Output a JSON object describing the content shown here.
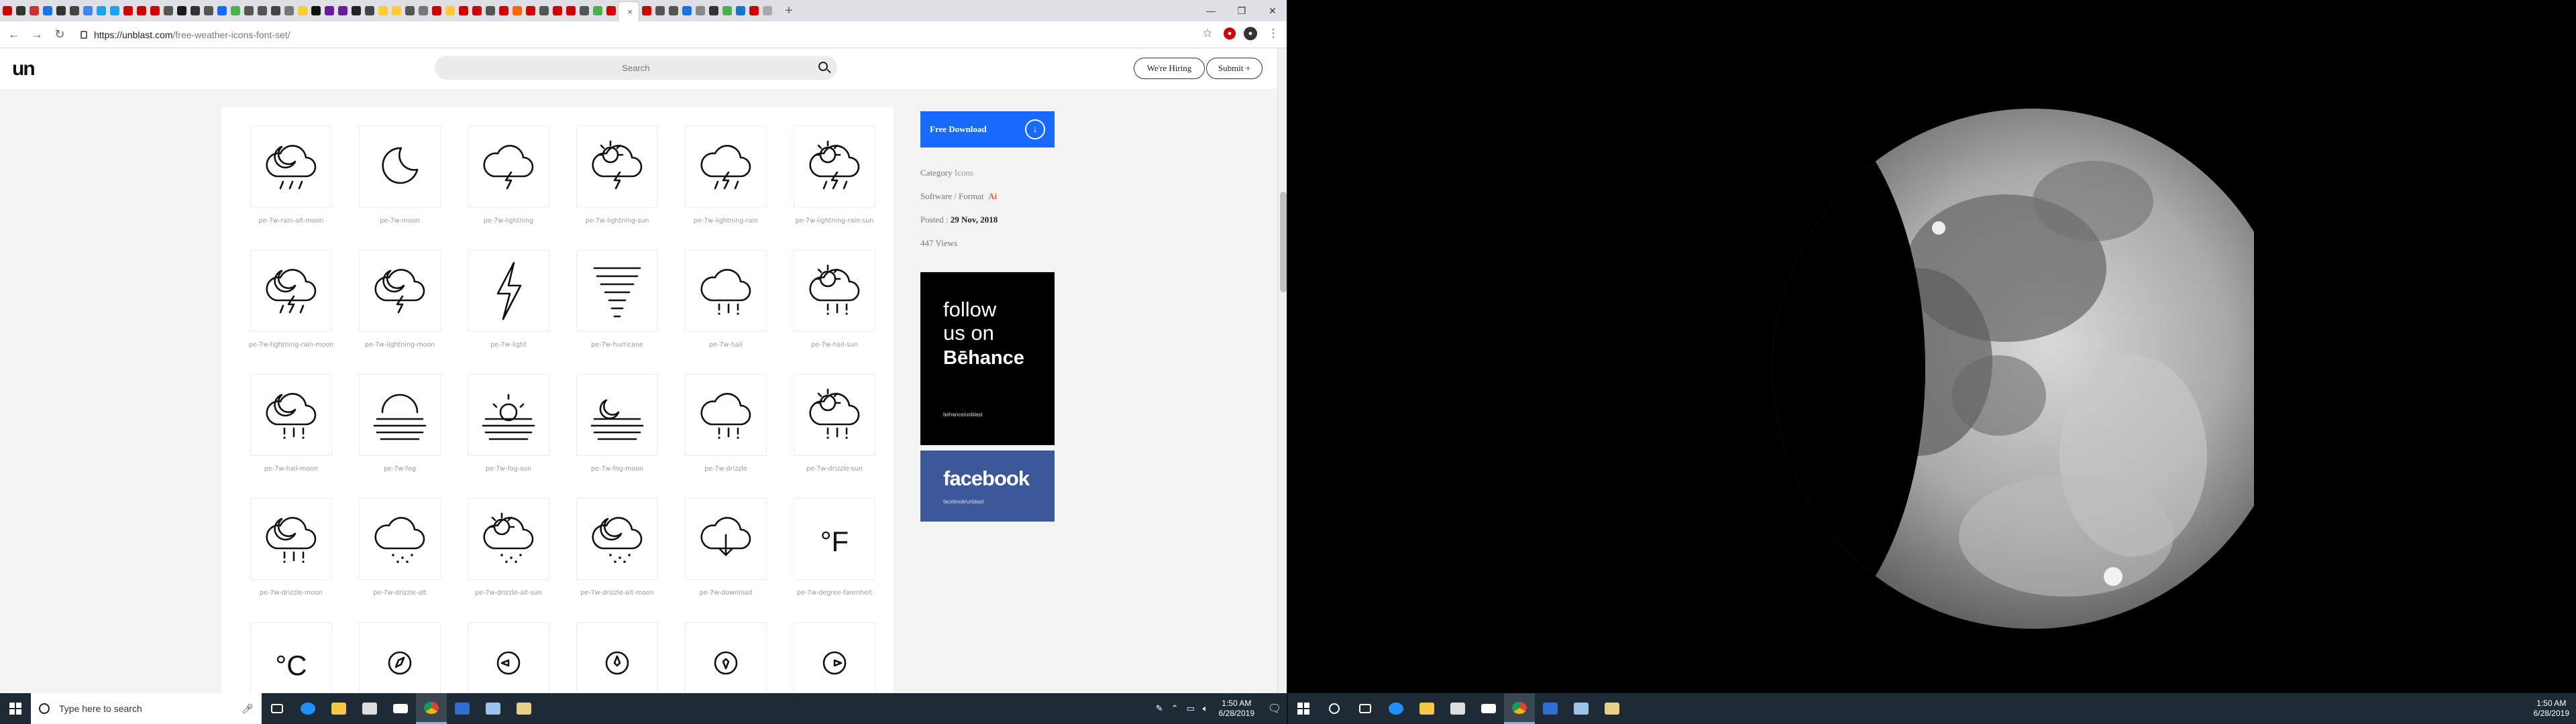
{
  "browser": {
    "url_host": "https://unblast.com",
    "url_path": "/free-weather-icons-font-set/",
    "tab_colors": [
      "#c00",
      "#333",
      "#c33",
      "#1a73e8",
      "#333",
      "#444",
      "#4285f4",
      "#1da1f2",
      "#1da1f2",
      "#c00",
      "#c00",
      "#c00",
      "#555",
      "#1a1a1a",
      "#333",
      "#555",
      "#1769ff",
      "#4caf50",
      "#555",
      "#555",
      "#444",
      "#777",
      "#fc3",
      "#111",
      "#6a1b9a",
      "#6a1b9a",
      "#222",
      "#444",
      "#fc3",
      "#fc3",
      "#555",
      "#777",
      "#c00",
      "#fc3",
      "#c00",
      "#c00",
      "#555",
      "#c00",
      "#f60",
      "#c00",
      "#555",
      "#c00",
      "#c00",
      "#555",
      "#4caf50",
      "#c00",
      "#c00",
      "#555",
      "#555",
      "#1a73e8",
      "#888",
      "#333",
      "#4caf50",
      "#1976d2",
      "#c00",
      "#aaa"
    ],
    "new_tab_label": "+",
    "active_tab_close": "×"
  },
  "site": {
    "logo": "un",
    "search_placeholder": "Search",
    "hiring_label": "We're Hiring",
    "submit_label": "Submit +"
  },
  "icons": [
    {
      "name": "pe-7w-rain-alt-moon",
      "glyph": "cloud-moon-rain"
    },
    {
      "name": "pe-7w-moon",
      "glyph": "moon"
    },
    {
      "name": "pe-7w-lightning",
      "glyph": "cloud-lightning"
    },
    {
      "name": "pe-7w-lightning-sun",
      "glyph": "cloud-sun-lightning"
    },
    {
      "name": "pe-7w-lightning-rain",
      "glyph": "cloud-lightning-rain"
    },
    {
      "name": "pe-7w-lightning-rain-sun",
      "glyph": "cloud-sun-lightning-rain"
    },
    {
      "name": "pe-7w-lightning-rain-moon",
      "glyph": "cloud-moon-lightning-rain"
    },
    {
      "name": "pe-7w-lightning-moon",
      "glyph": "cloud-moon-lightning"
    },
    {
      "name": "pe-7w-light",
      "glyph": "bolt"
    },
    {
      "name": "pe-7w-hurricane",
      "glyph": "hurricane"
    },
    {
      "name": "pe-7w-hail",
      "glyph": "cloud-hail"
    },
    {
      "name": "pe-7w-hail-sun",
      "glyph": "cloud-sun-hail"
    },
    {
      "name": "pe-7w-hail-moon",
      "glyph": "cloud-moon-hail"
    },
    {
      "name": "pe-7w-fog",
      "glyph": "fog"
    },
    {
      "name": "pe-7w-fog-sun",
      "glyph": "fog-sun"
    },
    {
      "name": "pe-7w-fog-moon",
      "glyph": "fog-moon"
    },
    {
      "name": "pe-7w-drizzle",
      "glyph": "cloud-drizzle"
    },
    {
      "name": "pe-7w-drizzle-sun",
      "glyph": "cloud-sun-drizzle"
    },
    {
      "name": "pe-7w-drizzle-moon",
      "glyph": "cloud-moon-drizzle"
    },
    {
      "name": "pe-7w-drizzle-alt",
      "glyph": "cloud-drizzle-alt"
    },
    {
      "name": "pe-7w-drizzle-alt-sun",
      "glyph": "cloud-sun-drizzle-alt"
    },
    {
      "name": "pe-7w-drizzle-alt-moon",
      "glyph": "cloud-moon-drizzle-alt"
    },
    {
      "name": "pe-7w-download",
      "glyph": "cloud-download"
    },
    {
      "name": "pe-7w-degree-farenheit",
      "glyph": "°F"
    },
    {
      "name": "",
      "glyph": "°C"
    },
    {
      "name": "",
      "glyph": "compass-1"
    },
    {
      "name": "",
      "glyph": "compass-2"
    },
    {
      "name": "",
      "glyph": "compass-3"
    },
    {
      "name": "",
      "glyph": "compass-4"
    },
    {
      "name": "",
      "glyph": "compass-5"
    }
  ],
  "sidebar": {
    "download_label": "Free Download",
    "category_label": "Category",
    "category_value": "Icons",
    "format_label": "Software / Format",
    "format_value": "Ai",
    "posted_label": "Posted :",
    "posted_value": "29 Nov, 2018",
    "views": "447 Views",
    "behance_line1": "follow",
    "behance_line2": "us on",
    "behance_line3": "Bēhance",
    "behance_handle": "behance/unblast",
    "facebook_name": "facebook",
    "facebook_handle": "facebook/unblast"
  },
  "taskbar": {
    "search_placeholder": "Type here to search",
    "time": "1:50 AM",
    "date": "6/28/2019",
    "time2": "1:50 AM",
    "date2": "6/28/2019"
  }
}
